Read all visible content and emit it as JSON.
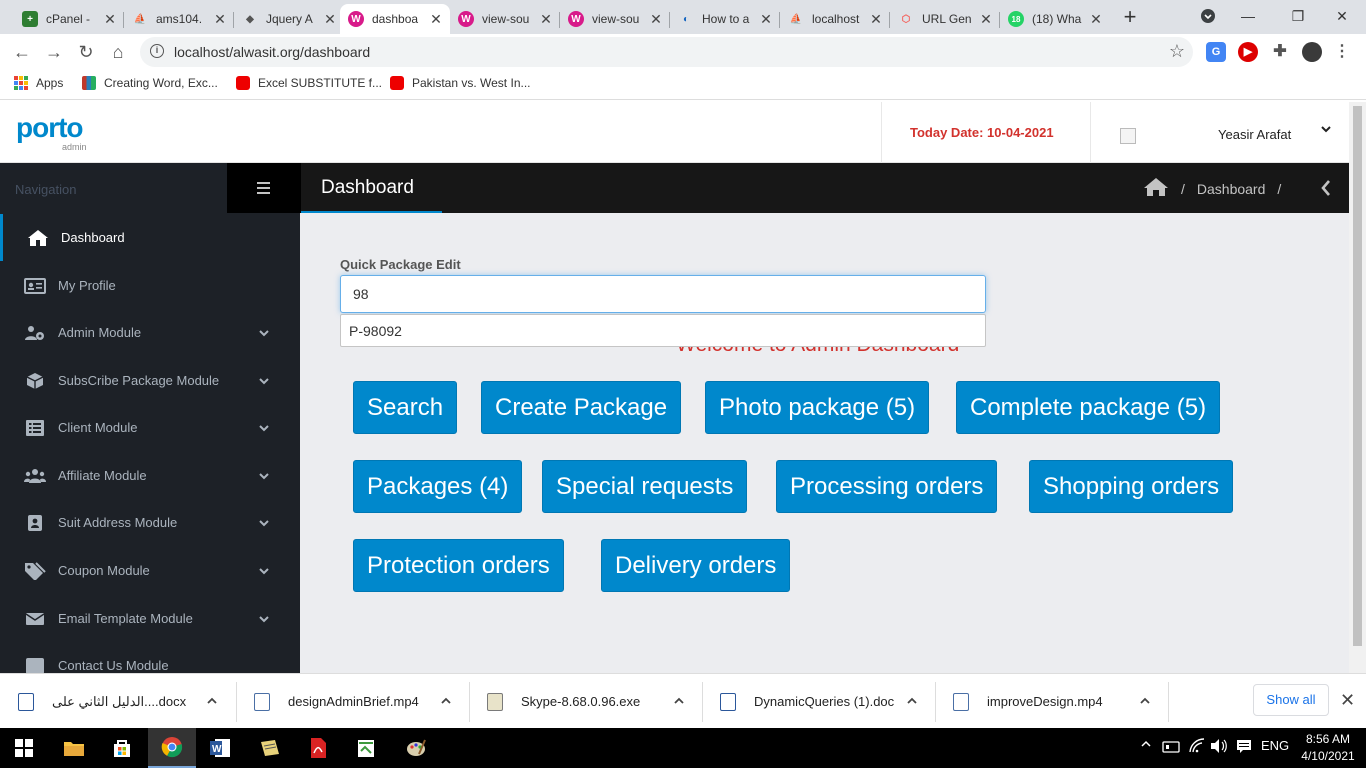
{
  "browser": {
    "tabs": [
      {
        "title": "cPanel -",
        "icon": "cpanel-icon",
        "color": "#2e7d32"
      },
      {
        "title": "ams104.",
        "icon": "phpmyadmin-icon",
        "color": "#f29111"
      },
      {
        "title": "Jquery A",
        "icon": "codegrepper-icon",
        "color": "#555555"
      },
      {
        "title": "dashboa",
        "icon": "site-icon",
        "color": "#d81b8a",
        "active": true
      },
      {
        "title": "view-sou",
        "icon": "site-icon",
        "color": "#d81b8a"
      },
      {
        "title": "view-sou",
        "icon": "site-icon",
        "color": "#d81b8a"
      },
      {
        "title": "How to a",
        "icon": "tutorial-icon",
        "color": "#1565c0"
      },
      {
        "title": "localhost",
        "icon": "phpmyadmin-icon",
        "color": "#f29111"
      },
      {
        "title": "URL Gen",
        "icon": "laravel-icon",
        "color": "#f4645f"
      },
      {
        "title": "(18) Wha",
        "icon": "whatsapp-icon",
        "color": "#25d366",
        "badge": "18"
      }
    ],
    "url": "localhost/alwasit.org/dashboard",
    "bookmarks": [
      {
        "label": "Apps"
      },
      {
        "label": "Creating Word, Exc..."
      },
      {
        "label": "Excel SUBSTITUTE f..."
      },
      {
        "label": "Pakistan vs. West In..."
      }
    ]
  },
  "header": {
    "logo": "porto",
    "logo_sub": "admin",
    "today": "Today Date: 10-04-2021",
    "user_name": "Yeasir Arafat"
  },
  "sidebar": {
    "title": "Navigation",
    "items": [
      {
        "label": "Dashboard",
        "icon": "home-icon",
        "active": true,
        "caret": false
      },
      {
        "label": "My Profile",
        "icon": "id-card-icon",
        "caret": false
      },
      {
        "label": "Admin Module",
        "icon": "users-cog-icon",
        "caret": true
      },
      {
        "label": "SubsCribe Package Module",
        "icon": "box-icon",
        "caret": true
      },
      {
        "label": "Client Module",
        "icon": "list-icon",
        "caret": true
      },
      {
        "label": "Affiliate Module",
        "icon": "users-icon",
        "caret": true
      },
      {
        "label": "Suit Address Module",
        "icon": "address-icon",
        "caret": true
      },
      {
        "label": "Coupon Module",
        "icon": "tags-icon",
        "caret": true
      },
      {
        "label": "Email Template Module",
        "icon": "envelope-icon",
        "caret": true
      },
      {
        "label": "Contact Us Module",
        "icon": "contact-icon",
        "caret": false
      }
    ]
  },
  "page": {
    "title": "Dashboard",
    "breadcrumb": [
      "Dashboard"
    ],
    "quick_edit_label": "Quick Package Edit",
    "quick_edit_value": "98",
    "suggestion": "P-98092",
    "welcome": "Welcome to Admin Dashboard",
    "buttons": [
      "Search",
      "Create Package",
      "Photo package (5)",
      "Complete package (5)",
      "Packages (4)",
      "Special requests",
      "Processing orders",
      "Shopping orders",
      "Protection orders",
      "Delivery orders"
    ]
  },
  "downloads": {
    "items": [
      "الدليل الثاني على....docx",
      "designAdminBrief.mp4",
      "Skype-8.68.0.96.exe",
      "DynamicQueries (1).doc",
      "improveDesign.mp4"
    ],
    "show_all": "Show all"
  },
  "taskbar": {
    "lang": "ENG",
    "time": "8:56 AM",
    "date": "4/10/2021"
  },
  "colors": {
    "primary": "#0088cc",
    "danger": "#d2322d",
    "sidebar_bg": "#1d2127",
    "content_bg": "#ecedf0"
  }
}
